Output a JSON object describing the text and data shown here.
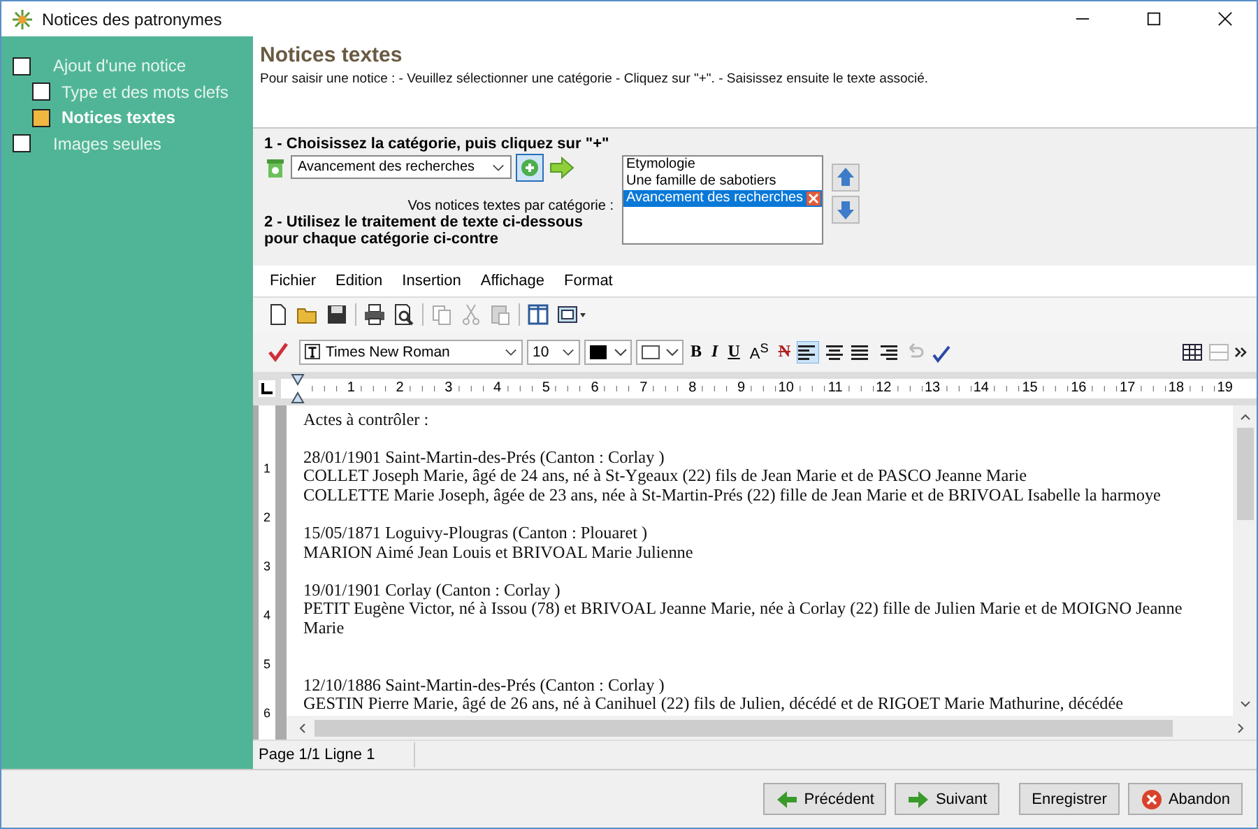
{
  "window": {
    "title": "Notices des patronymes"
  },
  "sidebar": {
    "steps": [
      {
        "label": "Ajout d'une notice",
        "selected": false,
        "children": [
          {
            "label": "Type et des mots clefs",
            "selected": false
          },
          {
            "label": "Notices textes",
            "selected": true
          }
        ]
      },
      {
        "label": "Images seules",
        "selected": false
      }
    ]
  },
  "header": {
    "title": "Notices textes",
    "instructions": "Pour saisir une notice : - Veuillez sélectionner une catégorie - Cliquez sur \"+\". - Saisissez ensuite le texte associé."
  },
  "category_step": {
    "heading": "1 - Choisissez la catégorie, puis cliquez sur \"+\"",
    "category_select": "Avancement des recherches",
    "list_label": "Vos notices textes par catégorie :",
    "categories": [
      {
        "label": "Etymologie",
        "selected": false
      },
      {
        "label": "Une famille de sabotiers",
        "selected": false
      },
      {
        "label": "Avancement des recherches",
        "selected": true
      }
    ],
    "editor_heading": "2 - Utilisez le traitement de texte ci-dessous pour chaque catégorie ci-contre"
  },
  "editor": {
    "menu": [
      "Fichier",
      "Edition",
      "Insertion",
      "Affichage",
      "Format"
    ],
    "font": "Times New Roman",
    "font_size": "10",
    "style_buttons": [
      {
        "kind": "bold",
        "label": "B"
      },
      {
        "kind": "italic",
        "label": "I"
      },
      {
        "kind": "underline",
        "label": "U"
      },
      {
        "kind": "superscript",
        "label": "A$^{S}$"
      },
      {
        "kind": "strike",
        "label": "N"
      }
    ],
    "alignments": [
      {
        "kind": "left",
        "selected": true
      },
      {
        "kind": "center",
        "selected": false
      },
      {
        "kind": "justify",
        "selected": false
      },
      {
        "kind": "right",
        "selected": false
      }
    ],
    "ruler": [
      "1",
      "2",
      "3",
      "4",
      "5",
      "6",
      "7",
      "8",
      "9",
      "10",
      "11",
      "12",
      "13",
      "14",
      "15",
      "16",
      "17",
      "18",
      "19"
    ],
    "side_ruler": [
      "1",
      "2",
      "3",
      "4",
      "5",
      "6"
    ],
    "paragraphs": [
      {
        "extra_space_before": false,
        "lines": [
          "Actes à contrôler :"
        ]
      },
      {
        "extra_space_before": false,
        "lines": [
          "28/01/1901 Saint-Martin-des-Prés (Canton : Corlay )",
          "COLLET Joseph Marie, âgé de 24 ans, né à St-Ygeaux (22) fils de  Jean Marie  et de  PASCO Jeanne Marie",
          "COLLETTE Marie Joseph, âgée de 23 ans, née à St-Martin-Prés (22) fille de Jean Marie  et de BRIVOAL Isabelle la harmoye"
        ]
      },
      {
        "extra_space_before": false,
        "lines": [
          "15/05/1871 Loguivy-Plougras (Canton : Plouaret )",
          "MARION Aimé Jean Louis et BRIVOAL  Marie Julienne"
        ]
      },
      {
        "extra_space_before": false,
        "lines": [
          "19/01/1901 Corlay (Canton : Corlay )",
          "PETIT Eugène Victor, né à Issou (78) et BRIVOAL Jeanne Marie, née à Corlay (22) fille de Julien Marie  et de MOIGNO Jeanne Marie"
        ]
      },
      {
        "extra_space_before": true,
        "lines": [
          "12/10/1886 Saint-Martin-des-Prés (Canton : Corlay )",
          "GESTIN Pierre Marie, âgé de 26 ans, né à Canihuel (22) fils de  Julien,  décédé et de  RIGOET Marie Mathurine, décédée"
        ]
      }
    ],
    "status": "Page 1/1 Ligne 1"
  },
  "buttons": [
    {
      "kind": "back",
      "label": "Précédent"
    },
    {
      "kind": "next",
      "label": "Suivant"
    },
    {
      "kind": "save",
      "label": "Enregistrer"
    },
    {
      "kind": "cancel",
      "label": "Abandon"
    }
  ]
}
